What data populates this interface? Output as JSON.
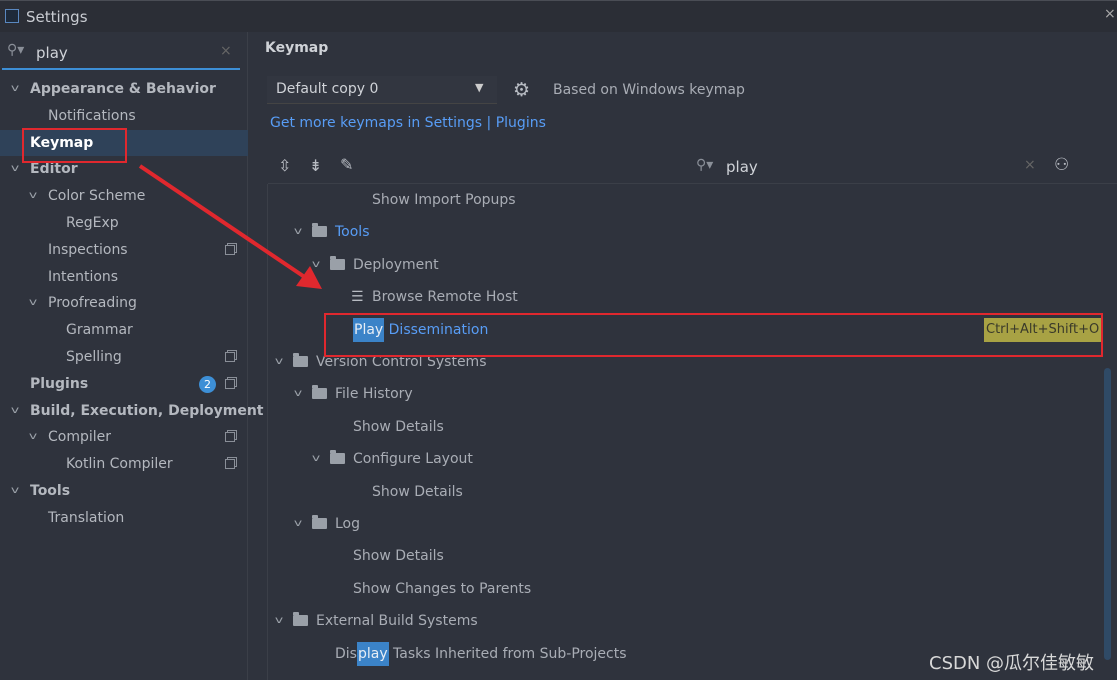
{
  "window": {
    "title": "Settings",
    "close_icon": "close-icon"
  },
  "sidebar": {
    "search": {
      "value": "play"
    },
    "items": [
      {
        "label": "Appearance & Behavior"
      },
      {
        "label": "Notifications"
      },
      {
        "label": "Keymap"
      },
      {
        "label": "Editor"
      },
      {
        "label": "Color Scheme"
      },
      {
        "label": "RegExp"
      },
      {
        "label": "Inspections"
      },
      {
        "label": "Intentions"
      },
      {
        "label": "Proofreading"
      },
      {
        "label": "Grammar"
      },
      {
        "label": "Spelling"
      },
      {
        "label": "Plugins",
        "badge": "2"
      },
      {
        "label": "Build, Execution, Deployment"
      },
      {
        "label": "Compiler"
      },
      {
        "label": "Kotlin Compiler"
      },
      {
        "label": "Tools"
      },
      {
        "label": "Translation"
      }
    ]
  },
  "main": {
    "title": "Keymap",
    "keymap_select": "Default copy 0",
    "based_on": "Based on Windows keymap",
    "get_more_link": "Get more keymaps in Settings | Plugins",
    "search": {
      "value": "play"
    },
    "tree": [
      {
        "label": "Show Import Popups"
      },
      {
        "label": "Tools"
      },
      {
        "label": "Deployment"
      },
      {
        "label": "Browse Remote Host"
      },
      {
        "match": "Play",
        "rest": " Dissemination",
        "shortcut": "Ctrl+Alt+Shift+O"
      },
      {
        "label": "Version Control Systems"
      },
      {
        "label": "File History"
      },
      {
        "label": "Show Details"
      },
      {
        "label": "Configure Layout"
      },
      {
        "label": "Show Details"
      },
      {
        "label": "Log"
      },
      {
        "label": "Show Details"
      },
      {
        "label": "Show Changes to Parents"
      },
      {
        "label": "External Build Systems"
      },
      {
        "pre": "Dis",
        "match": "play",
        "rest": " Tasks Inherited from Sub-Projects"
      }
    ]
  },
  "watermark": "CSDN @瓜尔佳敏敏",
  "colors": {
    "accent": "#3d8fd6",
    "annotation": "#e0282e",
    "shortcut_bg": "#a8a244"
  }
}
